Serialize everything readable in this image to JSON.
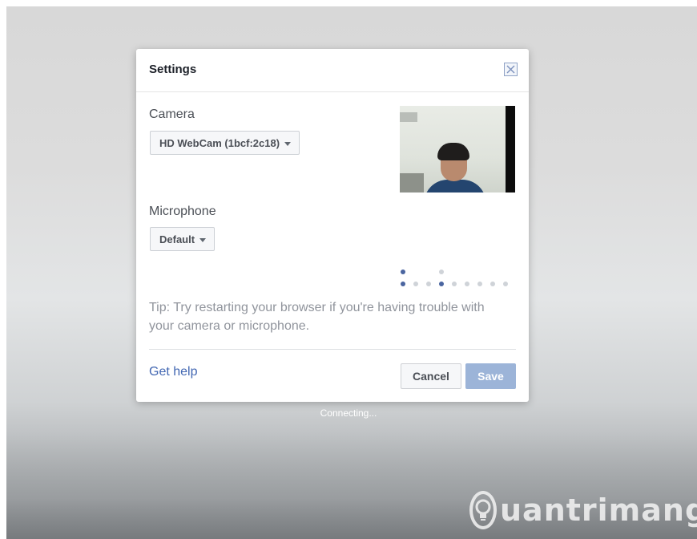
{
  "dialog": {
    "title": "Settings",
    "close_icon": "close-icon",
    "camera": {
      "label": "Camera",
      "selected": "HD WebCam (1bcf:2c18)"
    },
    "microphone": {
      "label": "Microphone",
      "selected": "Default"
    },
    "mic_level": {
      "segments": 9,
      "active_segments": [
        0,
        3
      ],
      "raised_segments": [
        0,
        3
      ]
    },
    "tip": "Tip: Try restarting your browser if you're having trouble with your camera or microphone.",
    "get_help_label": "Get help",
    "cancel_label": "Cancel",
    "save_label": "Save"
  },
  "status": {
    "connecting_text": "Connecting..."
  },
  "watermark": {
    "text": "uantrimang"
  },
  "colors": {
    "accent": "#4267b2",
    "save_disabled": "#9cb4d8",
    "meter_active": "#4a65a0",
    "meter_inactive": "#cfd3d8"
  }
}
